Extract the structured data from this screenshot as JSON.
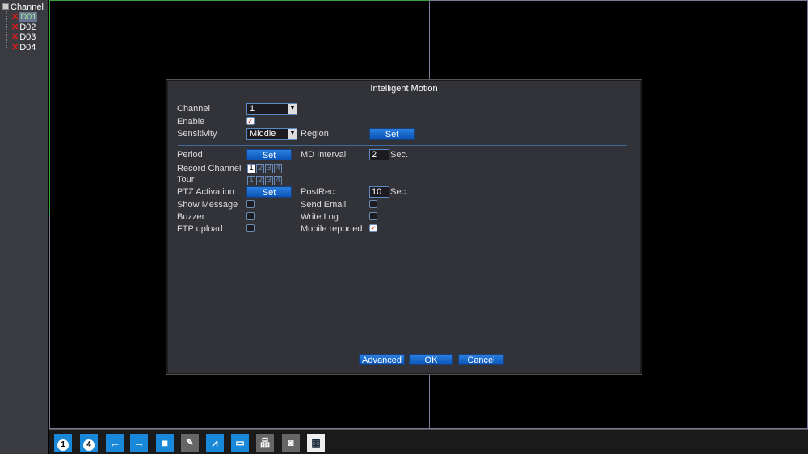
{
  "sidebar": {
    "title": "Channel",
    "channels": [
      {
        "label": "D01",
        "selected": true,
        "status": "disconnected"
      },
      {
        "label": "D02",
        "status": "disconnected"
      },
      {
        "label": "D03",
        "status": "disconnected"
      },
      {
        "label": "D04",
        "status": "disconnected"
      }
    ]
  },
  "dialog": {
    "title": "Intelligent Motion",
    "channel_label": "Channel",
    "channel_value": "1",
    "enable_label": "Enable",
    "enable_checked": true,
    "sensitivity_label": "Sensitivity",
    "sensitivity_value": "Middle",
    "region_label": "Region",
    "set_label": "Set",
    "period_label": "Period",
    "md_interval_label": "MD Interval",
    "md_interval_value": "2",
    "sec_label": "Sec.",
    "record_channel_label": "Record Channel",
    "tour_label": "Tour",
    "channel_numbers": [
      "1",
      "2",
      "3",
      "4"
    ],
    "ptz_label": "PTZ Activation",
    "postrec_label": "PostRec",
    "postrec_value": "10",
    "show_message_label": "Show Message",
    "send_email_label": "Send Email",
    "buzzer_label": "Buzzer",
    "write_log_label": "Write Log",
    "ftp_label": "FTP upload",
    "mobile_label": "Mobile reported",
    "mobile_checked": true,
    "advanced_label": "Advanced",
    "ok_label": "OK",
    "cancel_label": "Cancel"
  },
  "toolbar": {
    "icons": [
      "single-view-icon",
      "quad-view-icon",
      "previous-icon",
      "next-icon",
      "fullscreen-icon",
      "ptz-camera-icon",
      "chart-icon",
      "monitor-icon",
      "network-icon",
      "hdd-icon",
      "qr-code-icon"
    ],
    "single_label": "1",
    "quad_label": "4"
  },
  "colors": {
    "accent": "#1a88d8",
    "selected_border": "#3aa03a",
    "disconnected": "#e01818"
  }
}
